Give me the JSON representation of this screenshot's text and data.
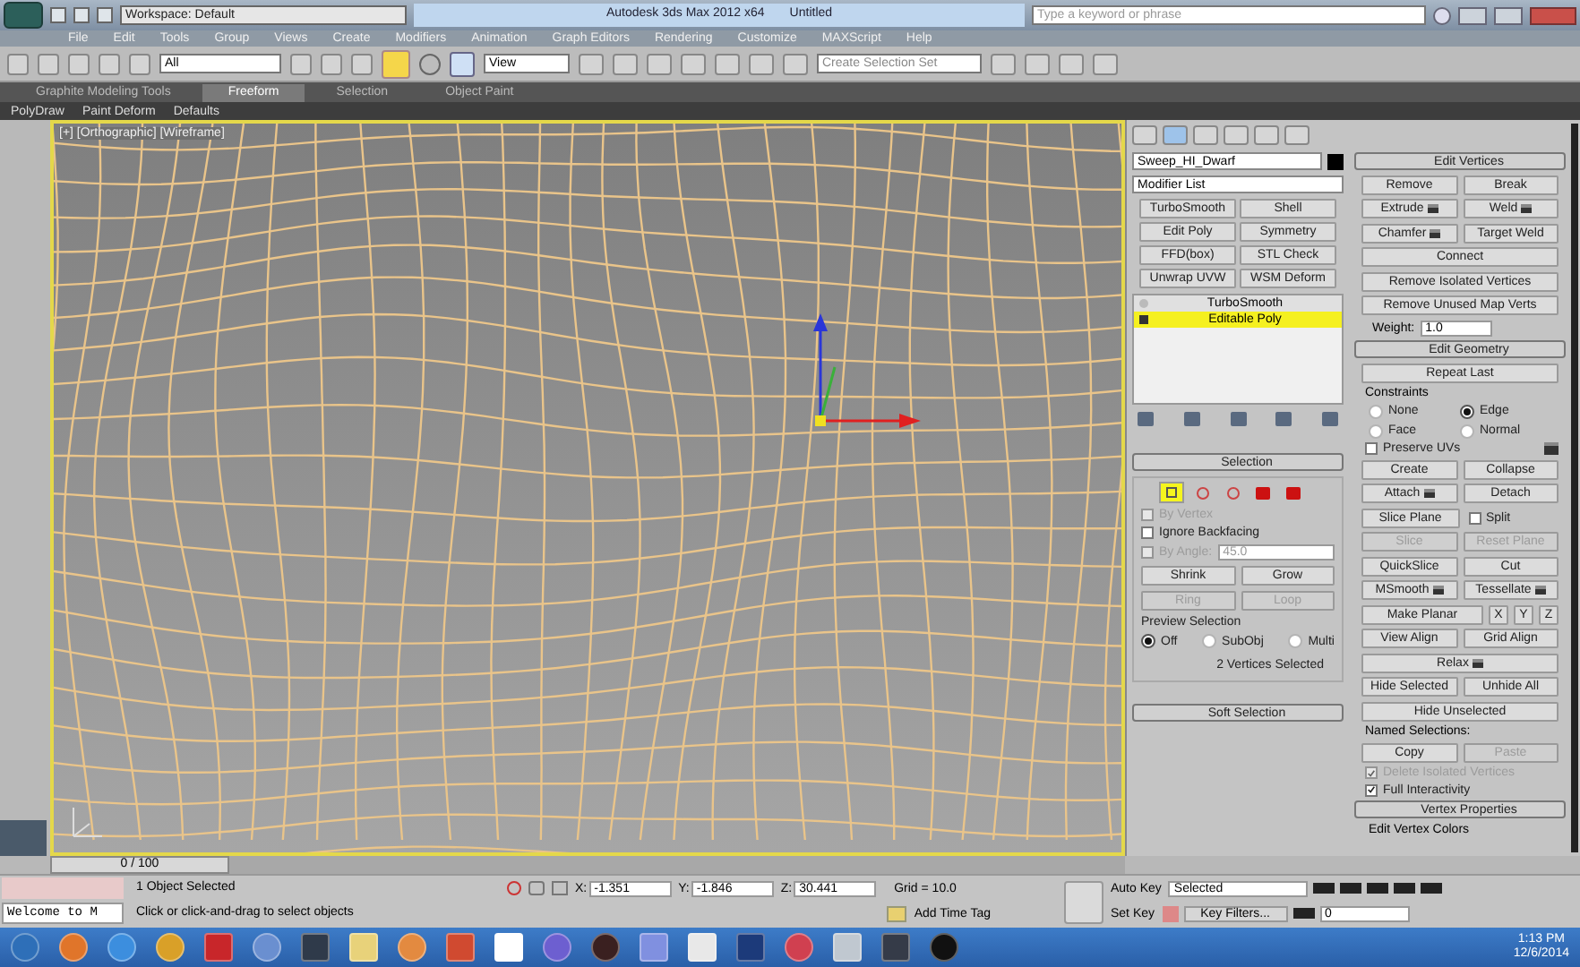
{
  "title_bar": {
    "workspace": "Workspace: Default",
    "title": "Autodesk 3ds Max 2012 x64",
    "document": "Untitled",
    "search": {
      "placeholder": "Type a keyword or phrase"
    }
  },
  "menu": [
    "File",
    "Edit",
    "Tools",
    "Group",
    "Views",
    "Create",
    "Modifiers",
    "Animation",
    "Graph Editors",
    "Rendering",
    "Customize",
    "MAXScript",
    "Help"
  ],
  "toolbar": {
    "filter": "All",
    "reference": "View",
    "selection_set": "Create Selection Set"
  },
  "ribbon": {
    "tabs": [
      {
        "label": "Graphite Modeling Tools",
        "selected": false
      },
      {
        "label": "Freeform",
        "selected": true
      },
      {
        "label": "Selection",
        "selected": false
      },
      {
        "label": "Object Paint",
        "selected": false
      }
    ],
    "panels": [
      "PolyDraw",
      "Paint Deform",
      "Defaults"
    ]
  },
  "viewport": {
    "label": "[+] [Orthographic] [Wireframe]"
  },
  "time_slider": {
    "label": "0 / 100",
    "level": 0
  },
  "command_panel": {
    "object_name": "Sweep_HI_Dwarf",
    "modifier_list": "Modifier List",
    "modifier_buttons": [
      "TurboSmooth",
      "Shell",
      "Edit Poly",
      "Symmetry",
      "FFD(box)",
      "STL Check",
      "Unwrap UVW",
      "WSM Deform"
    ],
    "stack": [
      {
        "label": "TurboSmooth",
        "selected": false
      },
      {
        "label": "Editable Poly",
        "selected": true
      }
    ],
    "selection": {
      "title": "Selection",
      "levels": [
        {
          "kind": "vertex",
          "selected": true
        },
        {
          "kind": "edge",
          "selected": false
        },
        {
          "kind": "border",
          "selected": false
        },
        {
          "kind": "polygon",
          "selected": false
        },
        {
          "kind": "element",
          "selected": false
        }
      ],
      "options": [
        {
          "label": "By Vertex",
          "checked": false,
          "disabled": true
        },
        {
          "label": "Ignore Backfacing",
          "checked": false,
          "disabled": false
        }
      ],
      "by_angle": {
        "label": "By Angle:",
        "value": "45.0",
        "checked": false,
        "disabled": true
      },
      "buttons": [
        {
          "label": "Shrink",
          "disabled": false
        },
        {
          "label": "Grow",
          "disabled": false
        },
        {
          "label": "Ring",
          "disabled": true
        },
        {
          "label": "Loop",
          "disabled": true
        }
      ],
      "preview": {
        "title": "Preview Selection",
        "options": [
          {
            "label": "Off",
            "selected": true
          },
          {
            "label": "SubObj",
            "selected": false
          },
          {
            "label": "Multi",
            "selected": false
          }
        ]
      },
      "status": "2 Vertices Selected"
    },
    "soft_selection": {
      "title": "Soft Selection"
    },
    "edit_vertices": {
      "title": "Edit Vertices",
      "rows": [
        [
          {
            "kind": "button",
            "label": "Remove",
            "disabled": false
          },
          {
            "kind": "button",
            "label": "Break",
            "disabled": false
          }
        ],
        [
          {
            "kind": "settings_button",
            "label": "Extrude",
            "disabled": false
          },
          {
            "kind": "settings_button",
            "label": "Weld",
            "disabled": false
          }
        ],
        [
          {
            "kind": "settings_button",
            "label": "Chamfer",
            "disabled": false
          },
          {
            "kind": "button",
            "label": "Target Weld",
            "disabled": false
          }
        ],
        [
          {
            "kind": "button",
            "label": "Connect",
            "disabled": false
          }
        ],
        [
          {
            "kind": "button",
            "label": "Remove Isolated Vertices",
            "disabled": false
          }
        ],
        [
          {
            "kind": "button",
            "label": "Remove Unused Map Verts",
            "disabled": false
          }
        ]
      ],
      "weight": {
        "label": "Weight:",
        "value": "1.0"
      }
    },
    "edit_geometry": {
      "title": "Edit Geometry",
      "repeat_last": "Repeat Last",
      "constraints": {
        "title": "Constraints",
        "options": [
          {
            "label": "None",
            "selected": false
          },
          {
            "label": "Edge",
            "selected": true
          },
          {
            "label": "Face",
            "selected": false
          },
          {
            "label": "Normal",
            "selected": false
          }
        ]
      },
      "rows": [
        [
          {
            "kind": "checkbox",
            "label": "Preserve UVs",
            "checked": false,
            "disabled": false
          },
          {
            "kind": "settings_icon",
            "disabled": false
          }
        ],
        [
          {
            "kind": "button",
            "label": "Create",
            "disabled": false
          },
          {
            "kind": "button",
            "label": "Collapse",
            "disabled": false
          }
        ],
        [
          {
            "kind": "settings_button",
            "label": "Attach",
            "disabled": false
          },
          {
            "kind": "button",
            "label": "Detach",
            "disabled": false
          }
        ],
        [
          {
            "kind": "button",
            "label": "Slice Plane",
            "disabled": false
          },
          {
            "kind": "checkbox",
            "label": "Split",
            "checked": false,
            "disabled": false
          }
        ],
        [
          {
            "kind": "button",
            "label": "Slice",
            "disabled": true
          },
          {
            "kind": "button",
            "label": "Reset Plane",
            "disabled": true
          }
        ],
        [
          {
            "kind": "button",
            "label": "QuickSlice",
            "disabled": false
          },
          {
            "kind": "button",
            "label": "Cut",
            "disabled": false
          }
        ],
        [
          {
            "kind": "settings_button",
            "label": "MSmooth",
            "disabled": false
          },
          {
            "kind": "settings_button",
            "label": "Tessellate",
            "disabled": false
          }
        ],
        [
          {
            "kind": "button",
            "label": "Make Planar",
            "disabled": false
          },
          {
            "kind": "axis",
            "label": "X",
            "disabled": false
          },
          {
            "kind": "axis",
            "label": "Y",
            "disabled": false
          },
          {
            "kind": "axis",
            "label": "Z",
            "disabled": false
          }
        ],
        [
          {
            "kind": "button",
            "label": "View Align",
            "disabled": false
          },
          {
            "kind": "button",
            "label": "Grid Align",
            "disabled": false
          }
        ],
        [
          {
            "kind": "settings_button",
            "label": "Relax",
            "disabled": false
          }
        ],
        [
          {
            "kind": "button",
            "label": "Hide Selected",
            "disabled": false
          },
          {
            "kind": "button",
            "label": "Unhide All",
            "disabled": false
          }
        ],
        [
          {
            "kind": "button",
            "label": "Hide Unselected",
            "disabled": false
          }
        ]
      ],
      "named_selections": {
        "title": "Named Selections:",
        "buttons": [
          {
            "label": "Copy",
            "disabled": false
          },
          {
            "label": "Paste",
            "disabled": true
          }
        ]
      },
      "checks": [
        {
          "label": "Delete Isolated Vertices",
          "checked": true,
          "disabled": true
        },
        {
          "label": "Full Interactivity",
          "checked": true,
          "disabled": false
        }
      ]
    },
    "vertex_properties": {
      "title": "Vertex Properties"
    },
    "edit_vertex_colors": {
      "title": "Edit Vertex Colors"
    }
  },
  "status_bar": {
    "maxscript": "Welcome to M",
    "selection": "1 Object Selected",
    "prompt": "Click or click-and-drag to select objects",
    "coords": [
      {
        "axis": "X:",
        "value": "-1.351"
      },
      {
        "axis": "Y:",
        "value": "-1.846"
      },
      {
        "axis": "Z:",
        "value": "30.441"
      }
    ],
    "grid": "Grid = 10.0",
    "time_tag": "Add Time Tag"
  },
  "animation": {
    "auto_key": "Auto Key",
    "key_set": "Selected",
    "set_key": "Set Key",
    "key_filters": "Key Filters...",
    "frame": "0"
  },
  "taskbar": {
    "time": "1:13 PM",
    "date": "12/6/2014"
  }
}
